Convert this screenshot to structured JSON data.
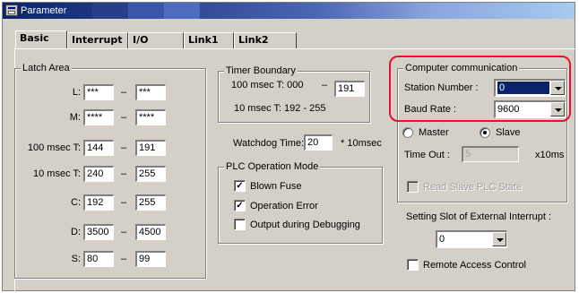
{
  "window": {
    "title": "Parameter",
    "tabs": [
      {
        "label": "Basic",
        "active": true
      },
      {
        "label": "Interrupt",
        "active": false
      },
      {
        "label": "I/O",
        "active": false
      },
      {
        "label": "Link1",
        "active": false
      },
      {
        "label": "Link2",
        "active": false
      }
    ]
  },
  "latch_area": {
    "label": "Latch Area",
    "dash": "–",
    "rows": [
      {
        "label": "L:",
        "from": "***",
        "to": "***"
      },
      {
        "label": "M:",
        "from": "****",
        "to": "****"
      },
      {
        "label": "100 msec T:",
        "from": "144",
        "to": "191"
      },
      {
        "label": "10 msec T:",
        "from": "240",
        "to": "255"
      },
      {
        "label": "C:",
        "from": "192",
        "to": "255"
      },
      {
        "label": "D:",
        "from": "3500",
        "to": "4500"
      },
      {
        "label": "S:",
        "from": "80",
        "to": "99"
      }
    ]
  },
  "timer_boundary": {
    "label": "Timer Boundary",
    "row1_label": "100 msec T: 000",
    "dash": "–",
    "row1_value": "191",
    "row2_text": "10 msec T: 192  -  255"
  },
  "watchdog": {
    "label": "Watchdog Time:",
    "value": "20",
    "unit": "* 10msec"
  },
  "plc_mode": {
    "label": "PLC Operation Mode",
    "options": [
      {
        "label": "Blown Fuse",
        "checked": true
      },
      {
        "label": "Operation Error",
        "checked": true
      },
      {
        "label": "Output during Debugging",
        "checked": false
      }
    ]
  },
  "computer_comm": {
    "label": "Computer communication",
    "station_label": "Station Number :",
    "station_value": "0",
    "baud_label": "Baud Rate :",
    "baud_value": "9600"
  },
  "mode": {
    "master_label": "Master",
    "slave_label": "Slave",
    "selected": "Slave"
  },
  "timeout": {
    "label": "Time Out :",
    "value": "5",
    "unit": "x10ms"
  },
  "read_slave": {
    "label": "Read Slave PLC State",
    "checked": false
  },
  "ext_interrupt": {
    "label": "Setting Slot of External Interrupt :",
    "value": "0"
  },
  "remote_access": {
    "label": "Remote Access Control",
    "checked": false
  },
  "colors": {
    "title_start": "#0a246a",
    "title_end": "#a6caf0",
    "highlight": "#e8102a",
    "face": "#d4d0c8"
  }
}
